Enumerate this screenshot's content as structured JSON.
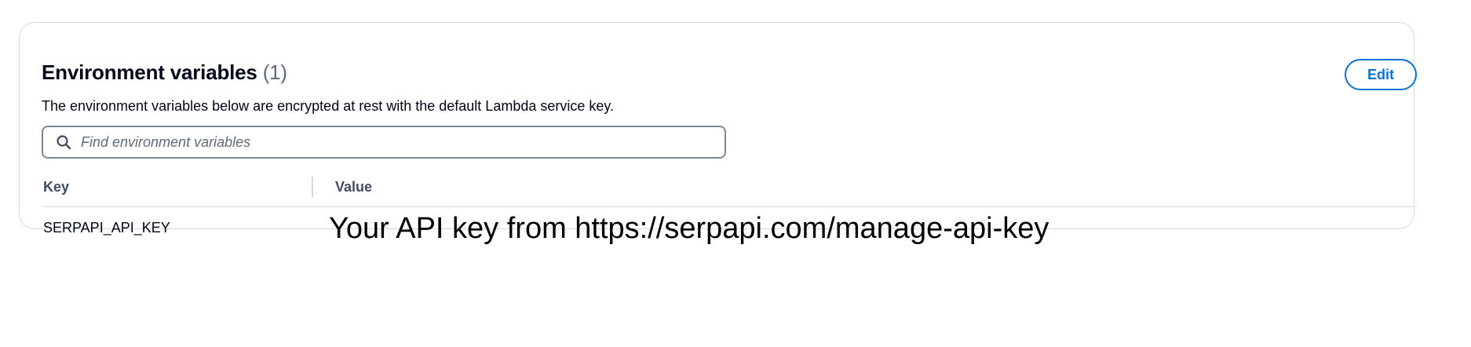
{
  "section": {
    "title": "Environment variables",
    "count": "(1)",
    "description": "The environment variables below are encrypted at rest with the default Lambda service key.",
    "edit_label": "Edit"
  },
  "search": {
    "icon": "search-icon",
    "placeholder": "Find environment variables",
    "value": ""
  },
  "table": {
    "columns": [
      "Key",
      "Value"
    ],
    "rows": [
      {
        "key": "SERPAPI_API_KEY",
        "value": "Your API key from https://serpapi.com/manage-api-key"
      }
    ]
  },
  "colors": {
    "accent": "#0972d3",
    "text": "#000716",
    "muted": "#5f6b7a",
    "border": "#d5dbdb"
  }
}
